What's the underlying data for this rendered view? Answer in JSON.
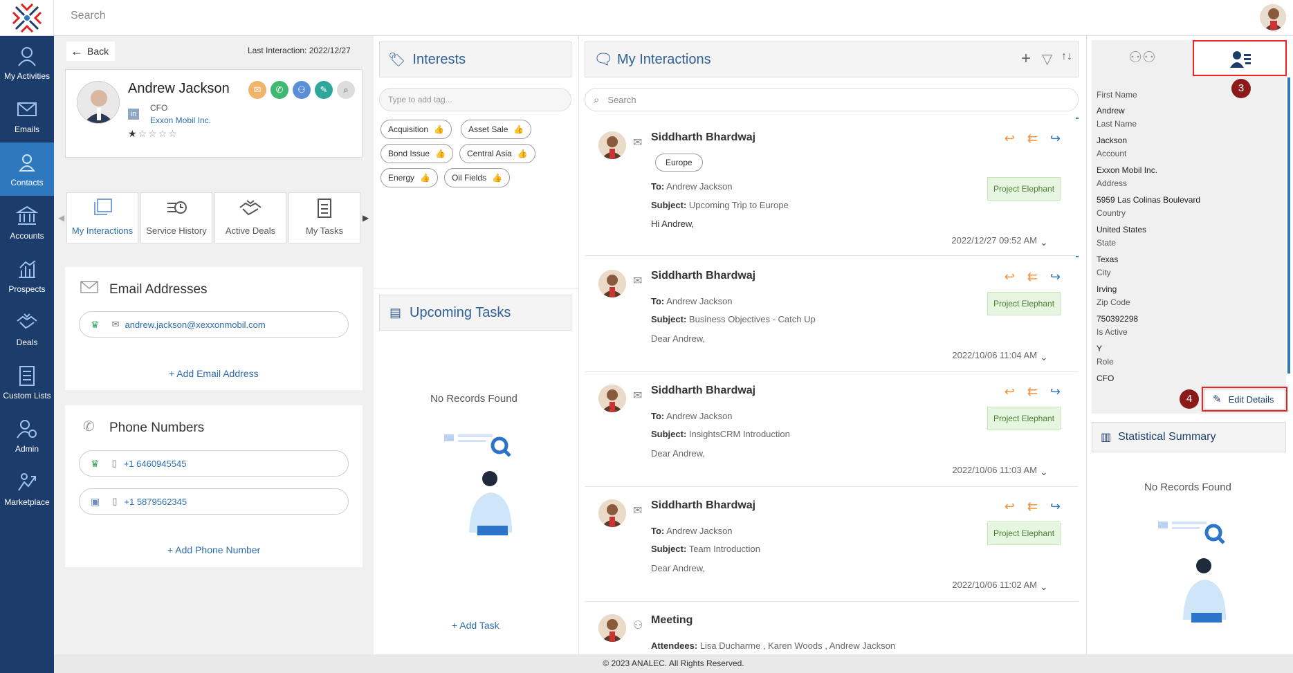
{
  "top": {
    "search_placeholder": "Search"
  },
  "nav": [
    {
      "label": "My Activities",
      "icon": "person-icon"
    },
    {
      "label": "Emails",
      "icon": "envelope-icon"
    },
    {
      "label": "Contacts",
      "icon": "contact-icon"
    },
    {
      "label": "Accounts",
      "icon": "bank-icon"
    },
    {
      "label": "Prospects",
      "icon": "chart-icon"
    },
    {
      "label": "Deals",
      "icon": "handshake-icon"
    },
    {
      "label": "Custom Lists",
      "icon": "list-icon"
    },
    {
      "label": "Admin",
      "icon": "admin-icon"
    },
    {
      "label": "Marketplace",
      "icon": "marketplace-icon"
    }
  ],
  "contact": {
    "back_label": "Back",
    "last_interaction": "Last Interaction: 2022/12/27",
    "name": "Andrew Jackson",
    "title": "CFO",
    "company": "Exxon Mobil Inc.",
    "rating": 1,
    "rating_max": 5
  },
  "tabs": [
    {
      "label": "My Interactions",
      "icon": "interactions-icon"
    },
    {
      "label": "Service History",
      "icon": "service-icon"
    },
    {
      "label": "Active Deals",
      "icon": "deals-icon"
    },
    {
      "label": "My Tasks",
      "icon": "tasks-icon"
    }
  ],
  "emails": {
    "heading": "Email Addresses",
    "items": [
      {
        "value": "andrew.jackson@xexxonmobil.com"
      }
    ],
    "add_label": "+ Add Email Address"
  },
  "phones": {
    "heading": "Phone Numbers",
    "items": [
      {
        "value": "+1 6460945545"
      },
      {
        "value": "+1 5879562345"
      }
    ],
    "add_label": "+ Add Phone Number"
  },
  "interests": {
    "heading": "Interests",
    "tag_placeholder": "Type to add tag...",
    "tags": [
      "Acquisition",
      "Asset Sale",
      "Bond Issue",
      "Central Asia",
      "Energy",
      "Oil Fields"
    ]
  },
  "tasks": {
    "heading": "Upcoming Tasks",
    "empty": "No Records Found",
    "add_label": "+ Add Task"
  },
  "interactions": {
    "heading": "My Interactions",
    "search_placeholder": "Search",
    "to_label": "To:",
    "subject_label": "Subject:",
    "attendees_label": "Attendees:",
    "items": [
      {
        "sender": "Siddharth Bhardwaj",
        "tag": "Europe",
        "to": "Andrew Jackson",
        "subject": "Upcoming Trip to Europe",
        "body": "Hi Andrew,",
        "project": "Project Elephant",
        "date": "2022/12/27 09:52 AM"
      },
      {
        "sender": "Siddharth Bhardwaj",
        "to": "Andrew Jackson",
        "subject": "Business Objectives - Catch Up",
        "body": "Dear Andrew,",
        "project": "Project Elephant",
        "date": "2022/10/06 11:04 AM"
      },
      {
        "sender": "Siddharth Bhardwaj",
        "to": "Andrew Jackson",
        "subject": "InsightsCRM Introduction",
        "body": "Dear Andrew,",
        "project": "Project Elephant",
        "date": "2022/10/06 11:03 AM"
      },
      {
        "sender": "Siddharth Bhardwaj",
        "to": "Andrew Jackson",
        "subject": "Team Introduction",
        "body": "Dear Andrew,",
        "project": "Project Elephant",
        "date": "2022/10/06 11:02 AM"
      },
      {
        "sender": "Meeting",
        "attendees": "Lisa Ducharme , Karen Woods , Andrew Jackson"
      }
    ]
  },
  "details": {
    "fields": [
      {
        "label": "First Name",
        "value": "Andrew"
      },
      {
        "label": "Last Name",
        "value": "Jackson"
      },
      {
        "label": "Account",
        "value": "Exxon Mobil Inc."
      },
      {
        "label": "Address",
        "value": "5959 Las Colinas Boulevard"
      },
      {
        "label": "Country",
        "value": "United States"
      },
      {
        "label": "State",
        "value": "Texas"
      },
      {
        "label": "City",
        "value": "Irving"
      },
      {
        "label": "Zip Code",
        "value": "750392298"
      },
      {
        "label": "Is Active",
        "value": "Y"
      },
      {
        "label": "Role",
        "value": "CFO"
      }
    ],
    "edit_label": "Edit Details",
    "marker3": "3",
    "marker4": "4"
  },
  "stats": {
    "heading": "Statistical Summary",
    "empty": "No Records Found"
  },
  "footer": "© 2023 ANALEC. All Rights Reserved."
}
